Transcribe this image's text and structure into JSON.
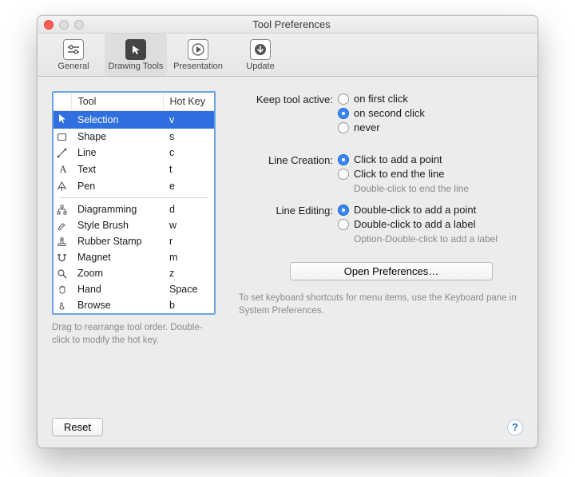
{
  "window": {
    "title": "Tool Preferences"
  },
  "toolbar": {
    "items": [
      {
        "label": "General"
      },
      {
        "label": "Drawing Tools"
      },
      {
        "label": "Presentation"
      },
      {
        "label": "Update"
      }
    ],
    "selected_index": 1
  },
  "table": {
    "headers": {
      "tool": "Tool",
      "hotkey": "Hot Key"
    },
    "rows_top": [
      {
        "name": "Selection",
        "key": "v",
        "selected": true
      },
      {
        "name": "Shape",
        "key": "s"
      },
      {
        "name": "Line",
        "key": "c"
      },
      {
        "name": "Text",
        "key": "t"
      },
      {
        "name": "Pen",
        "key": "e"
      }
    ],
    "rows_bottom": [
      {
        "name": "Diagramming",
        "key": "d"
      },
      {
        "name": "Style Brush",
        "key": "w"
      },
      {
        "name": "Rubber Stamp",
        "key": "r"
      },
      {
        "name": "Magnet",
        "key": "m"
      },
      {
        "name": "Zoom",
        "key": "z"
      },
      {
        "name": "Hand",
        "key": "Space"
      },
      {
        "name": "Browse",
        "key": "b"
      }
    ]
  },
  "table_hint": "Drag to rearrange tool order.  Double-click to modify the hot key.",
  "keep_tool": {
    "label": "Keep tool active:",
    "options": [
      "on first click",
      "on second click",
      "never"
    ],
    "selected": 1
  },
  "line_creation": {
    "label": "Line Creation:",
    "options": [
      "Click to add a point",
      "Click to end the line"
    ],
    "hint": "Double-click to end the line",
    "selected": 0
  },
  "line_editing": {
    "label": "Line Editing:",
    "options": [
      "Double-click to add a point",
      "Double-click to add a label"
    ],
    "hint": "Option-Double-click to add a label",
    "selected": 0
  },
  "open_prefs_label": "Open Preferences…",
  "right_hint": "To set keyboard shortcuts for menu items, use the Keyboard pane in System Preferences.",
  "reset_label": "Reset"
}
